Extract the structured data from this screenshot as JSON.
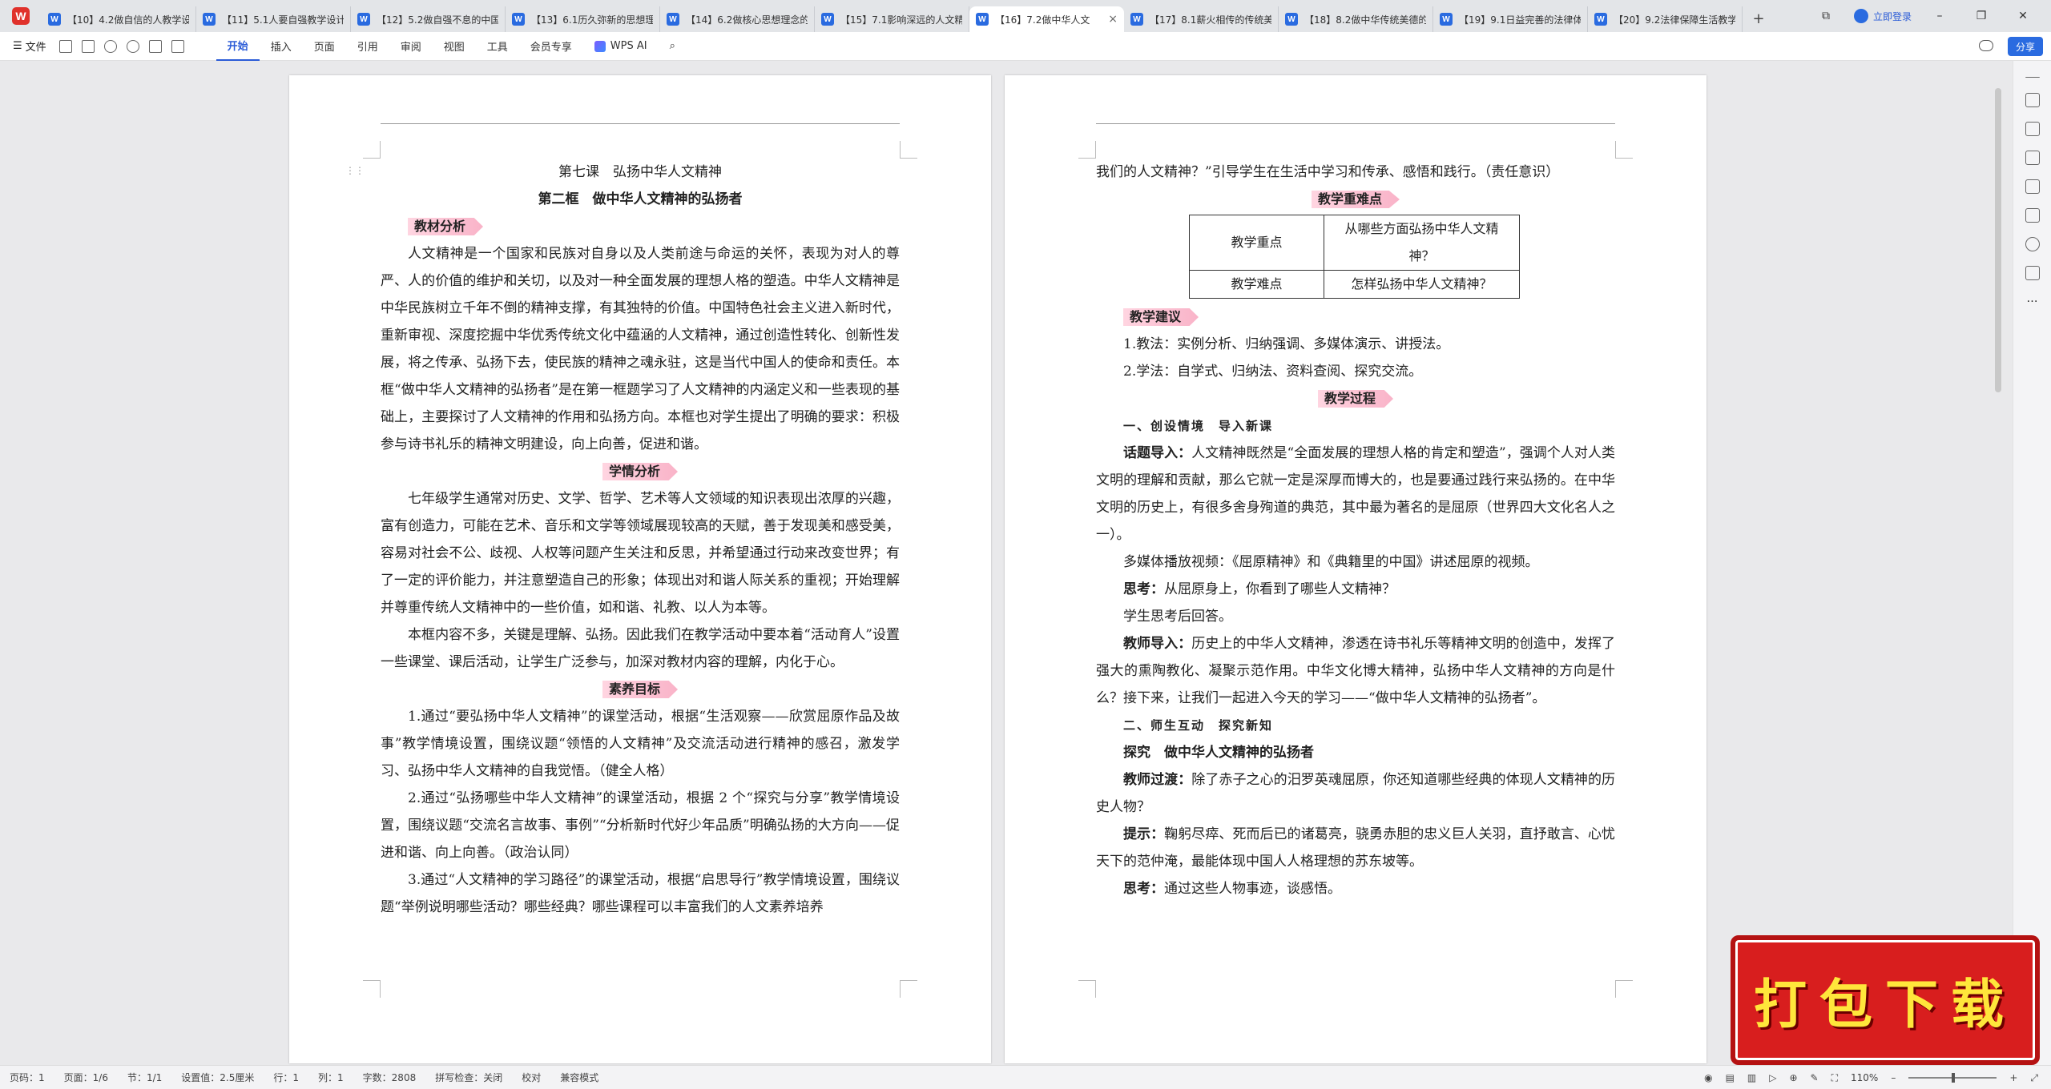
{
  "tabs": [
    {
      "label": "【10】4.2做自信的人教学设"
    },
    {
      "label": "【11】5.1人要自强教学设计"
    },
    {
      "label": "【12】5.2做自强不息的中国"
    },
    {
      "label": "【13】6.1历久弥新的思想理"
    },
    {
      "label": "【14】6.2做核心思想理念的"
    },
    {
      "label": "【15】7.1影响深远的人文精"
    },
    {
      "label": "【16】7.2做中华人文"
    },
    {
      "label": "【17】8.1薪火相传的传统美"
    },
    {
      "label": "【18】8.2做中华传统美德的"
    },
    {
      "label": "【19】9.1日益完善的法律体"
    },
    {
      "label": "【20】9.2法律保障生活教学"
    }
  ],
  "titlebar": {
    "login": "立即登录"
  },
  "ribbon": {
    "file": "文件",
    "tabs": [
      "开始",
      "插入",
      "页面",
      "引用",
      "审阅",
      "视图",
      "工具",
      "会员专享"
    ],
    "wps_ai": "WPS AI",
    "share": "分享"
  },
  "page1": {
    "title": "第七课　弘扬中华人文精神",
    "subtitle": "第二框　做中华人文精神的弘扬者",
    "h_material": "教材分析",
    "p_material": "人文精神是一个国家和民族对自身以及人类前途与命运的关怀，表现为对人的尊严、人的价值的维护和关切，以及对一种全面发展的理想人格的塑造。中华人文精神是中华民族树立千年不倒的精神支撑，有其独特的价值。中国特色社会主义进入新时代，重新审视、深度挖掘中华优秀传统文化中蕴涵的人文精神，通过创造性转化、创新性发展，将之传承、弘扬下去，使民族的精神之魂永驻，这是当代中国人的使命和责任。本框“做中华人文精神的弘扬者”是在第一框题学习了人文精神的内涵定义和一些表现的基础上，主要探讨了人文精神的作用和弘扬方向。本框也对学生提出了明确的要求：积极参与诗书礼乐的精神文明建设，向上向善，促进和谐。",
    "h_students": "学情分析",
    "p_students1": "七年级学生通常对历史、文学、哲学、艺术等人文领域的知识表现出浓厚的兴趣，富有创造力，可能在艺术、音乐和文学等领域展现较高的天赋，善于发现美和感受美，容易对社会不公、歧视、人权等问题产生关注和反思，并希望通过行动来改变世界；有了一定的评价能力，并注意塑造自己的形象；体现出对和谐人际关系的重视；开始理解并尊重传统人文精神中的一些价值，如和谐、礼教、以人为本等。",
    "p_students2": "本框内容不多，关键是理解、弘扬。因此我们在教学活动中要本着“活动育人”设置一些课堂、课后活动，让学生广泛参与，加深对教材内容的理解，内化于心。",
    "h_goals": "素养目标",
    "goal1": "1.通过“要弘扬中华人文精神”的课堂活动，根据“生活观察——欣赏屈原作品及故事”教学情境设置，围绕议题“领悟的人文精神”及交流活动进行精神的感召，激发学习、弘扬中华人文精神的自我觉悟。（健全人格）",
    "goal2": "2.通过“弘扬哪些中华人文精神”的课堂活动，根据 2 个“探究与分享”教学情境设置，围绕议题“交流名言故事、事例”“分析新时代好少年品质”明确弘扬的大方向——促进和谐、向上向善。（政治认同）",
    "goal3": "3.通过“人文精神的学习路径”的课堂活动，根据“启思导行”教学情境设置，围绕议题“举例说明哪些活动？哪些经典？哪些课程可以丰富我们的人文素养培养"
  },
  "page2": {
    "cont": "我们的人文精神？”引导学生在生活中学习和传承、感悟和践行。（责任意识）",
    "h_key": "教学重难点",
    "key_label": "教学重点",
    "key_value": "从哪些方面弘扬中华人文精神？",
    "diff_label": "教学难点",
    "diff_value": "怎样弘扬中华人文精神？",
    "h_suggest": "教学建议",
    "sug1": "1.教法：实例分析、归纳强调、多媒体演示、讲授法。",
    "sug2": "2.学法：自学式、归纳法、资料查阅、探究交流。",
    "h_process": "教学过程",
    "step1": "一、创设情境　导入新课",
    "intro_label": "话题导入：",
    "intro_text": "人文精神既然是“全面发展的理想人格的肯定和塑造”，强调个人对人类文明的理解和贡献，那么它就一定是深厚而博大的，也是要通过践行来弘扬的。在中华文明的历史上，有很多舍身殉道的典范，其中最为著名的是屈原（世界四大文化名人之一）。",
    "media": "多媒体播放视频：《屈原精神》和《典籍里的中国》讲述屈原的视频。",
    "think1_label": "思考：",
    "think1_text": "从屈原身上，你看到了哪些人文精神？",
    "answer": "学生思考后回答。",
    "teach_label": "教师导入：",
    "teach_text": "历史上的中华人文精神，渗透在诗书礼乐等精神文明的创造中，发挥了强大的熏陶教化、凝聚示范作用。中华文化博大精神，弘扬中华人文精神的方向是什么？接下来，让我们一起进入今天的学习——“做中华人文精神的弘扬者”。",
    "step2": "二、师生互动　探究新知",
    "explore": "探究　做中华人文精神的弘扬者",
    "trans_label": "教师过渡：",
    "trans_text": "除了赤子之心的汨罗英魂屈原，你还知道哪些经典的体现人文精神的历史人物？",
    "hint_label": "提示：",
    "hint_text": "鞠躬尽瘁、死而后已的诸葛亮，骁勇赤胆的忠义巨人关羽，直抒敢言、心忧天下的范仲淹，最能体现中国人人格理想的苏东坡等。",
    "think2_label": "思考：",
    "think2_text": "通过这些人物事迹，谈感悟。"
  },
  "promo": "打包下载",
  "status": {
    "page_code": "页码：1",
    "pages": "页面：1/6",
    "section": "节：1/1",
    "setting": "设置值：2.5厘米",
    "row": "行：1",
    "col": "列：1",
    "words": "字数：2808",
    "spell": "拼写检查：关闭",
    "proof": "校对",
    "compat": "兼容模式",
    "zoom": "110%"
  }
}
